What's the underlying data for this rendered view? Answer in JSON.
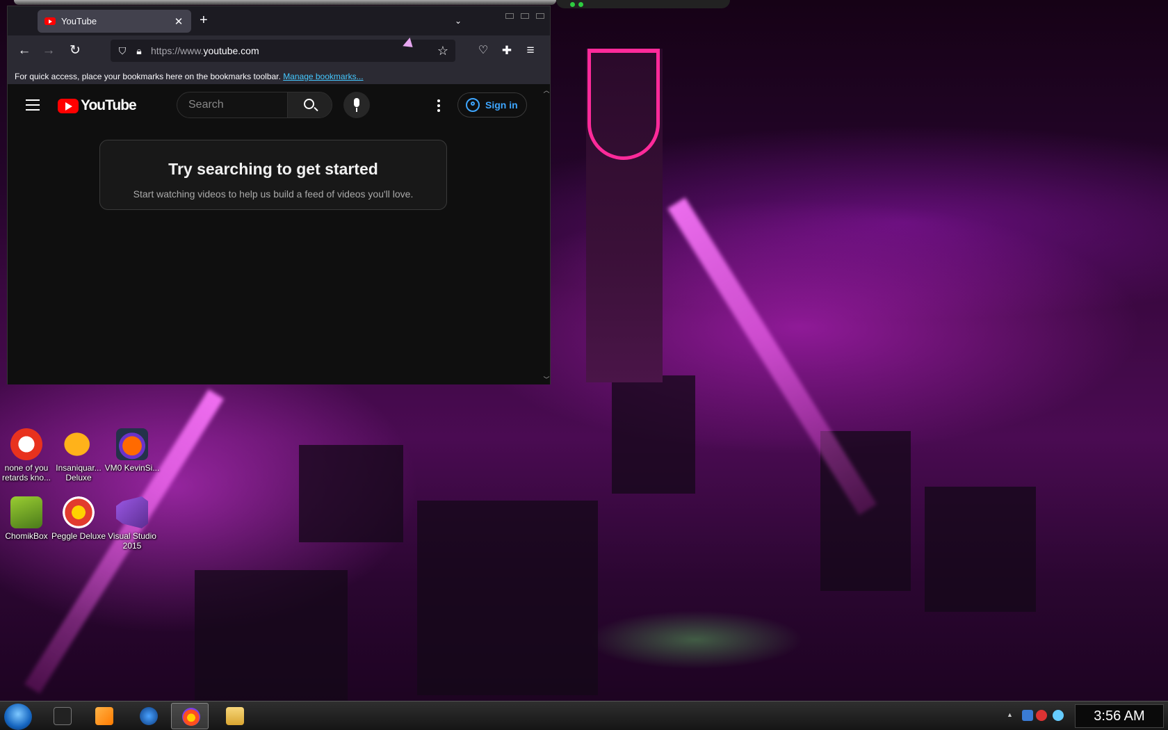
{
  "browser": {
    "tab_title": "YouTube",
    "tab_close": "✕",
    "new_tab": "+",
    "tab_list": "⌄",
    "url_prefix": "https://www.",
    "url_domain": "youtube.com",
    "bookmarks_text": "For quick access, place your bookmarks here on the bookmarks toolbar. ",
    "bookmarks_link": "Manage bookmarks...",
    "nav": {
      "back": "←",
      "forward": "→",
      "reload": "↻"
    },
    "icons": {
      "shield": "shield-icon",
      "lock": "lock-icon",
      "star": "star-icon",
      "pocket": "pocket-icon",
      "extensions": "extensions-icon",
      "menu": "menu-icon"
    }
  },
  "youtube": {
    "logo_text": "YouTube",
    "search_placeholder": "Search",
    "sign_in": "Sign in",
    "prompt_title": "Try searching to get started",
    "prompt_subtitle": "Start watching videos to help us build a feed of videos you'll love."
  },
  "desktop_icons": [
    {
      "label": "none of you retards kno...",
      "icon": "shark-icon"
    },
    {
      "label": "Insaniquar... Deluxe",
      "icon": "fish-icon"
    },
    {
      "label": "VM0 KevinSi...",
      "icon": "firefox-icon"
    },
    {
      "label": "ChomikBox",
      "icon": "chomikbox-icon"
    },
    {
      "label": "Peggle Deluxe",
      "icon": "peggle-icon"
    },
    {
      "label": "Visual Studio 2015",
      "icon": "visual-studio-icon"
    }
  ],
  "taskbar": {
    "clock": "3:56 AM",
    "tray_arrow": "▲"
  }
}
